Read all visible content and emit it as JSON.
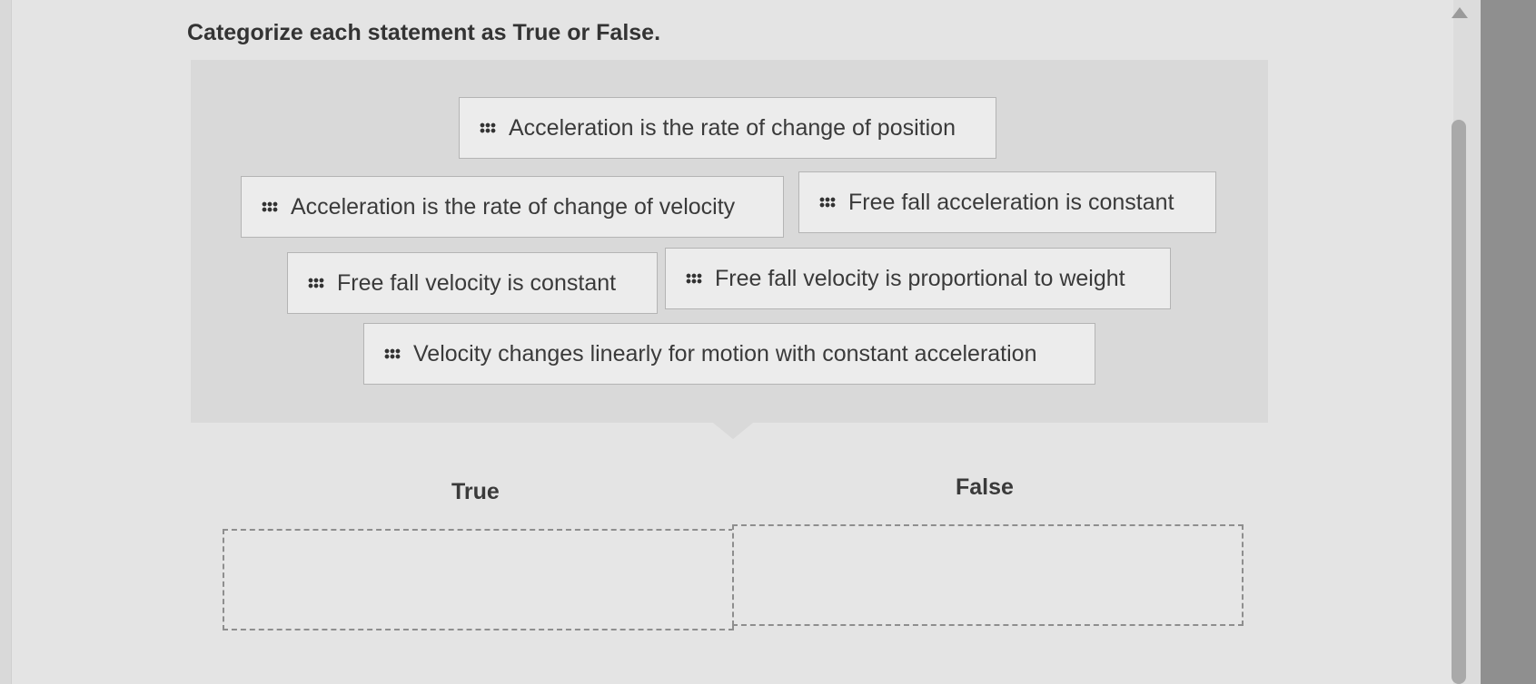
{
  "question": {
    "title": "Categorize each statement as True or False."
  },
  "statements": [
    "Acceleration is the rate of change of position",
    "Acceleration is the rate of change of velocity",
    "Free fall acceleration is constant",
    "Free fall velocity is constant",
    "Free fall velocity is proportional to weight",
    "Velocity changes linearly for motion with constant acceleration"
  ],
  "categories": {
    "true_label": "True",
    "false_label": "False"
  },
  "icons": {
    "grip": "drag-handle-icon",
    "scroll_up": "scroll-up-arrow-icon"
  },
  "colors": {
    "bank_background": "#d9d9d9",
    "chip_background": "#ececec",
    "chip_border": "#b4b4b4",
    "dropzone_border": "#8e8e8e"
  }
}
